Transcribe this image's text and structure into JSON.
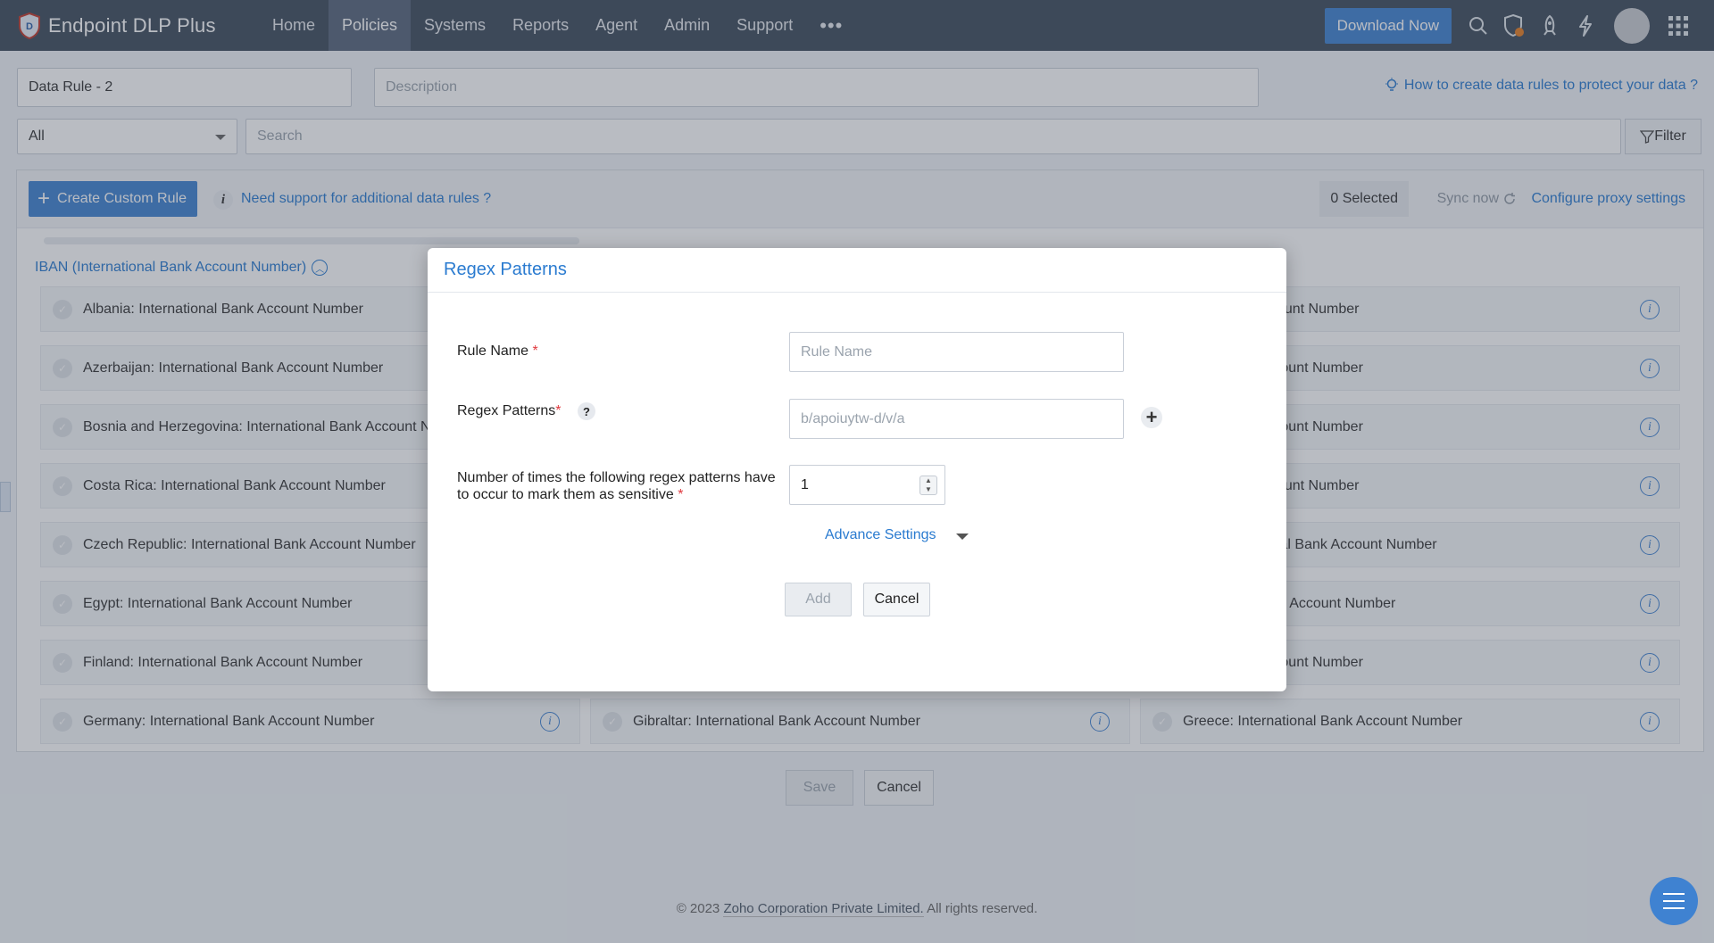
{
  "app": {
    "name": "Endpoint DLP Plus"
  },
  "nav": {
    "items": [
      {
        "label": "Home",
        "active": false
      },
      {
        "label": "Policies",
        "active": true
      },
      {
        "label": "Systems",
        "active": false
      },
      {
        "label": "Reports",
        "active": false
      },
      {
        "label": "Agent",
        "active": false
      },
      {
        "label": "Admin",
        "active": false
      },
      {
        "label": "Support",
        "active": false
      }
    ],
    "more": "•••",
    "download_label": "Download Now",
    "icons": [
      "search-icon",
      "shield-alert-icon",
      "rocket-icon",
      "lightning-icon",
      "user-avatar",
      "apps-grid-icon"
    ]
  },
  "form": {
    "rule_name_value": "Data Rule - 2",
    "description_placeholder": "Description",
    "help_link": "How to create data rules to protect your data ?",
    "category_selected": "All",
    "search_placeholder": "Search",
    "filter_label": "Filter"
  },
  "panel": {
    "create_label": "Create Custom Rule",
    "info": "i",
    "support_link": "Need support for additional data rules ?",
    "selected_count": "0 Selected",
    "sync_label": "Sync now",
    "proxy_link": "Configure proxy settings",
    "group_title": "IBAN (International Bank Account Number)",
    "col1": [
      "Albania: International Bank Account Number",
      "Azerbaijan: International Bank Account Number",
      "Bosnia and Herzegovina: International Bank Account Number",
      "Costa Rica: International Bank Account Number",
      "Czech Republic: International Bank Account Number",
      "Egypt: International Bank Account Number",
      "Finland: International Bank Account Number",
      "Germany: International Bank Account Number"
    ],
    "col2": [
      "Gibraltar: International Bank Account Number"
    ],
    "col3": [
      "ional Bank Account Number",
      "tional Bank Account Number",
      "tional Bank Account Number",
      "ional Bank Account Number",
      "blic: International Bank Account Number",
      "ternational Bank Account Number",
      "tional Bank Account Number",
      "Greece: International Bank Account Number"
    ]
  },
  "actions": {
    "save": "Save",
    "cancel": "Cancel"
  },
  "footer": {
    "prefix": "© 2023",
    "company": "Zoho Corporation Private Limited.",
    "suffix": "All rights reserved."
  },
  "modal": {
    "title": "Regex Patterns",
    "rule_name_label": "Rule Name",
    "rule_name_placeholder": "Rule Name",
    "regex_label": "Regex Patterns",
    "regex_help": "?",
    "regex_placeholder": "b/apoiuytw-d/v/a",
    "occurrence_label_1": "Number of times the following regex patterns have",
    "occurrence_label_2": "to occur to mark them as sensitive",
    "occurrence_value": "1",
    "required_mark": "*",
    "advance_settings": "Advance Settings",
    "add_label": "Add",
    "cancel_label": "Cancel"
  },
  "colors": {
    "accent": "#3f82d1",
    "link": "#2a7bd0",
    "topbar": "#3e4b5c",
    "required": "#e0393e"
  }
}
